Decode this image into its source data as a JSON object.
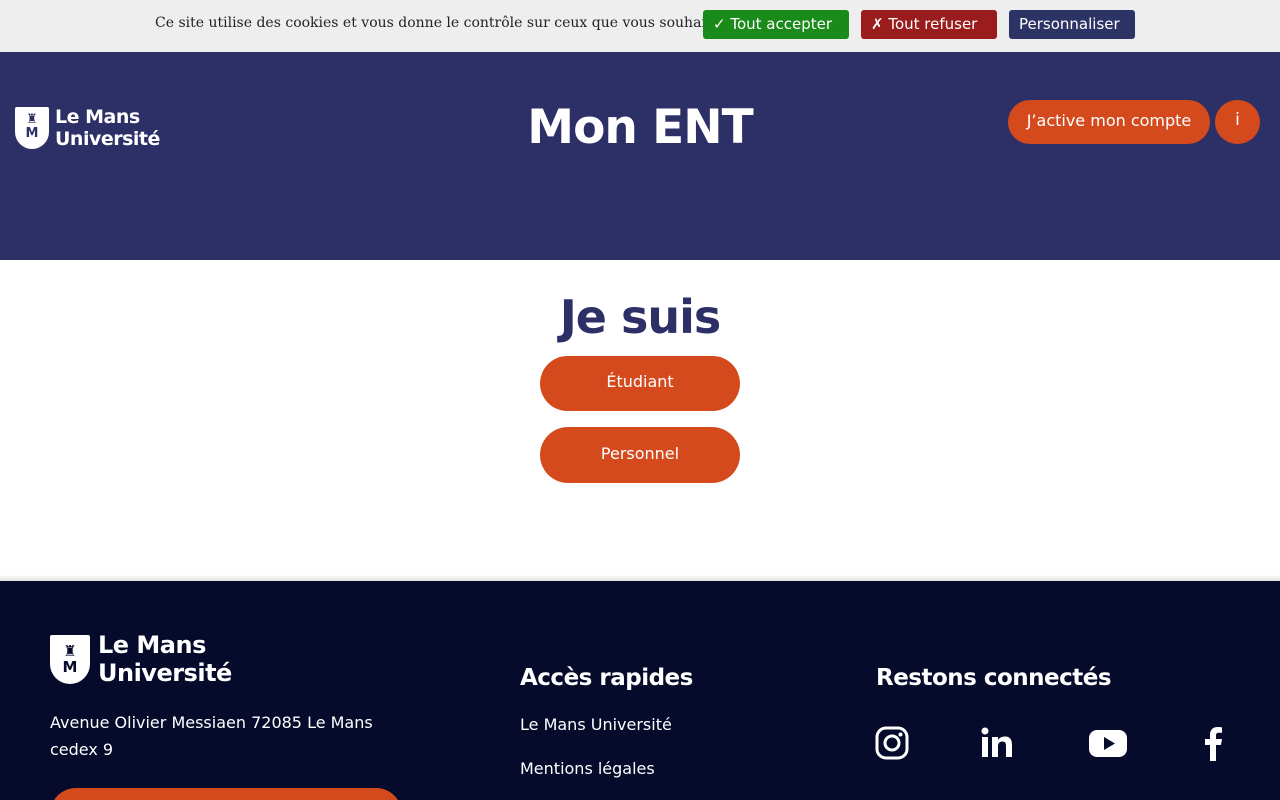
{
  "cookie_bar": {
    "message": "Ce site utilise des cookies et vous donne le contrôle sur ceux que vous souhaitez activer",
    "accept_label": "✓ Tout accepter",
    "refuse_label": "✗ Tout refuser",
    "customize_label": "Personnaliser"
  },
  "header": {
    "logo_line1": "Le Mans",
    "logo_line2": "Université",
    "title": "Mon ENT",
    "activate_label": "J’active mon compte",
    "info_label": "i"
  },
  "main": {
    "title": "Je suis",
    "buttons": [
      {
        "label": "Étudiant"
      },
      {
        "label": "Personnel"
      }
    ]
  },
  "footer": {
    "logo_line1": "Le Mans",
    "logo_line2": "Université",
    "address": "Avenue Olivier Messiaen 72085 Le Mans cedex 9",
    "quick_access_heading": "Accès rapides",
    "links": [
      {
        "label": "Le Mans Université"
      },
      {
        "label": "Mentions légales"
      }
    ],
    "social_heading": "Restons connectés",
    "social_icons": [
      "instagram-icon",
      "linkedin-icon",
      "youtube-icon",
      "facebook-icon"
    ]
  },
  "colors": {
    "header_bg": "#2c3066",
    "accent_orange": "#d44a1c",
    "footer_bg": "#060a2b",
    "accept_green": "#1a8a1a",
    "refuse_red": "#9b1c1c"
  }
}
